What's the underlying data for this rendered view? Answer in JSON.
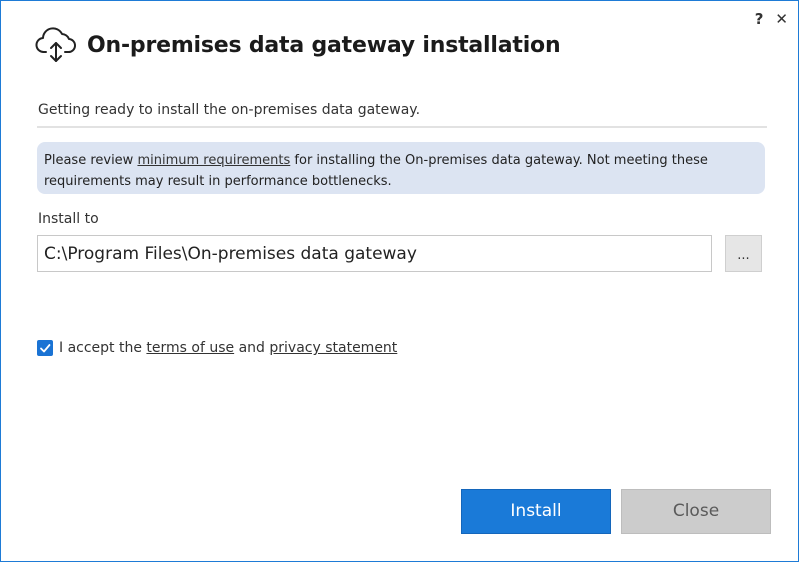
{
  "window": {
    "help_label": "?",
    "close_label": "✕"
  },
  "header": {
    "title": "On-premises data gateway installation"
  },
  "subtitle": "Getting ready to install the on-premises data gateway.",
  "notice": {
    "prefix": "Please review ",
    "link": "minimum requirements",
    "suffix": " for installing the On-premises data gateway. Not meeting these requirements may result in performance bottlenecks.",
    "background": "#dce4f2"
  },
  "install": {
    "label": "Install to",
    "path": "C:\\Program Files\\On-premises data gateway",
    "browse_label": "..."
  },
  "accept": {
    "checked": true,
    "prefix": "I accept the ",
    "terms_link": "terms of use",
    "middle": " and ",
    "privacy_link": "privacy statement"
  },
  "buttons": {
    "install_label": "Install",
    "close_label": "Close"
  },
  "colors": {
    "accent": "#1a7ad8",
    "window_border": "#1e7bd6"
  },
  "icons": {
    "header": "cloud-upload-icon",
    "checkbox": "checkmark-icon"
  }
}
